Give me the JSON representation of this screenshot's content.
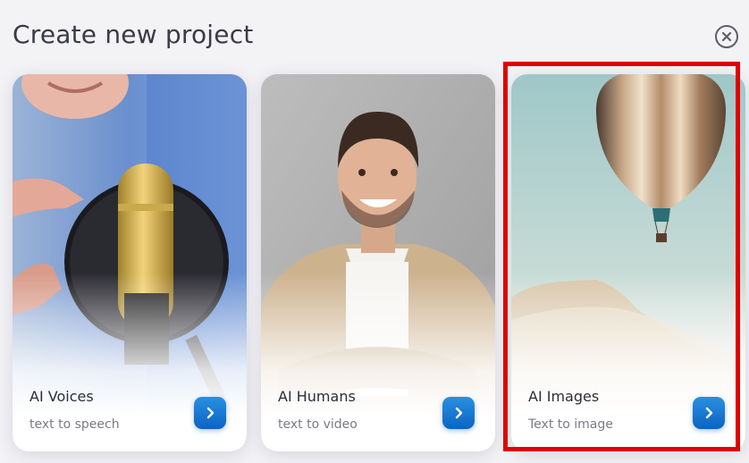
{
  "dialog": {
    "title": "Create new project",
    "close_icon": "close-circle-icon"
  },
  "cards": [
    {
      "label": "AI Voices",
      "sublabel": "text to speech",
      "photo": "microphone-photo",
      "action_icon": "chevron-right-icon"
    },
    {
      "label": "AI Humans",
      "sublabel": "text to video",
      "photo": "smiling-man-photo",
      "action_icon": "chevron-right-icon"
    },
    {
      "label": "AI Images",
      "sublabel": "Text to image",
      "photo": "hot-air-balloon-photo",
      "action_icon": "chevron-right-icon"
    }
  ],
  "colors": {
    "accent": "#0b64c2",
    "highlight": "#e00000",
    "background": "#f3f3f6"
  }
}
